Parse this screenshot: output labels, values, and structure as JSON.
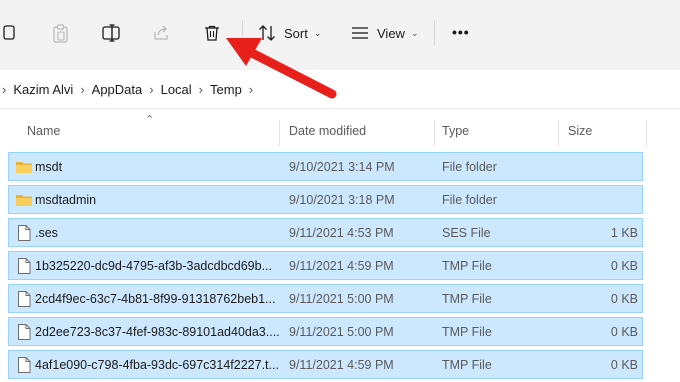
{
  "toolbar": {
    "sort_label": "Sort",
    "view_label": "View",
    "more_label": "•••",
    "icons": [
      "copy-icon",
      "paste-icon",
      "rename-icon",
      "share-icon",
      "delete-icon",
      "sort-icon",
      "view-icon",
      "more-icon"
    ]
  },
  "breadcrumb": {
    "items": [
      "Kazim Alvi",
      "AppData",
      "Local",
      "Temp"
    ]
  },
  "columns": {
    "name": "Name",
    "date": "Date modified",
    "type": "Type",
    "size": "Size"
  },
  "files": [
    {
      "name": "msdt",
      "date": "9/10/2021 3:14 PM",
      "type": "File folder",
      "size": "",
      "kind": "folder"
    },
    {
      "name": "msdtadmin",
      "date": "9/10/2021 3:18 PM",
      "type": "File folder",
      "size": "",
      "kind": "folder"
    },
    {
      "name": ".ses",
      "date": "9/11/2021 4:53 PM",
      "type": "SES File",
      "size": "1 KB",
      "kind": "file"
    },
    {
      "name": "1b325220-dc9d-4795-af3b-3adcdbcd69b...",
      "date": "9/11/2021 4:59 PM",
      "type": "TMP File",
      "size": "0 KB",
      "kind": "file"
    },
    {
      "name": "2cd4f9ec-63c7-4b81-8f99-91318762beb1...",
      "date": "9/11/2021 5:00 PM",
      "type": "TMP File",
      "size": "0 KB",
      "kind": "file"
    },
    {
      "name": "2d2ee723-8c37-4fef-983c-89101ad40da3....",
      "date": "9/11/2021 5:00 PM",
      "type": "TMP File",
      "size": "0 KB",
      "kind": "file"
    },
    {
      "name": "4af1e090-c798-4fba-93dc-697c314f2227.t...",
      "date": "9/11/2021 4:59 PM",
      "type": "TMP File",
      "size": "0 KB",
      "kind": "file"
    }
  ],
  "colors": {
    "selection_bg": "#cce8ff",
    "selection_border": "#99d1ff",
    "arrow": "#e8201c",
    "folder": "#f5c542"
  }
}
